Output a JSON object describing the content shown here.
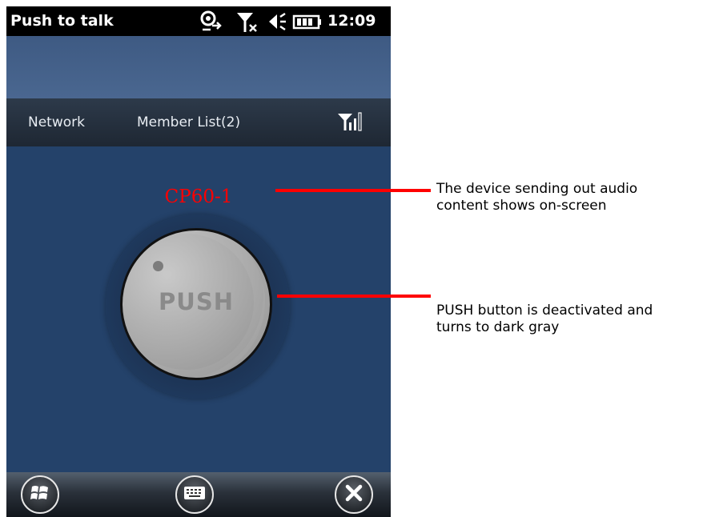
{
  "status_bar": {
    "app_title": "Push to talk",
    "time": "12:09",
    "icons": [
      "sync-icon",
      "no-signal-icon",
      "speaker-icon",
      "battery-icon"
    ]
  },
  "menu_bar": {
    "network_label": "Network",
    "member_list_label": "Member List(2)",
    "signal_icon": "signal-strength-icon"
  },
  "main": {
    "active_device": "CP60-1",
    "push_label": "PUSH"
  },
  "bottom_bar": {
    "icons": [
      "windows-start-icon",
      "keyboard-icon",
      "close-icon"
    ]
  },
  "annotations": {
    "device_callout": [
      "The device sending out audio",
      "content shows on-screen"
    ],
    "push_callout": [
      "PUSH button is deactivated and",
      "turns to dark gray"
    ]
  },
  "colors": {
    "active_device_text": "#ff0000",
    "callout_line": "#ff0000",
    "main_background": "#24426a",
    "status_bar": "#000000"
  }
}
